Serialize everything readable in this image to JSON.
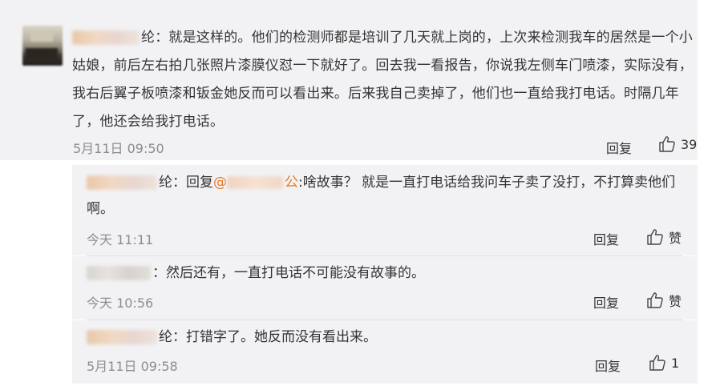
{
  "main_comment": {
    "name_suffix": "纶：",
    "text": "就是这样的。他们的检测师都是培训了几天就上岗的，上次来检测我车的居然是一个小姑娘，前后左右拍几张照片漆膜仪怼一下就好了。回去我一看报告，你说我左侧车门喷漆，实际没有，我右后翼子板喷漆和钣金她反而可以看出来。后来我自己卖掉了，他们也一直给我打电话。时隔几年了，他还会给我打电话。",
    "time": "5月11日 09:50",
    "reply_label": "回复",
    "like_count": "39"
  },
  "replies": [
    {
      "name_suffix": "纶：",
      "reply_prefix": "回复",
      "at_prefix": "@",
      "at_suffix": "公",
      "text": ":啥故事？ 就是一直打电话给我问车子卖了没打，不打算卖他们啊。",
      "time": "今天 11:11",
      "reply_label": "回复",
      "like_label": "赞"
    },
    {
      "name_suffix": "：",
      "text": "然后还有，一直打电话不可能没有故事的。",
      "time": "今天 10:56",
      "reply_label": "回复",
      "like_label": "赞"
    },
    {
      "name_suffix": "纶：",
      "text": "打错字了。她反而没有看出来。",
      "time": "5月11日 09:58",
      "reply_label": "回复",
      "like_label": "1"
    }
  ],
  "icons": {
    "like": "thumbs-up-icon"
  },
  "colors": {
    "card_bg": "#f2f2f5",
    "text": "#333333",
    "meta": "#8c8c8c",
    "mention": "#e87722"
  }
}
